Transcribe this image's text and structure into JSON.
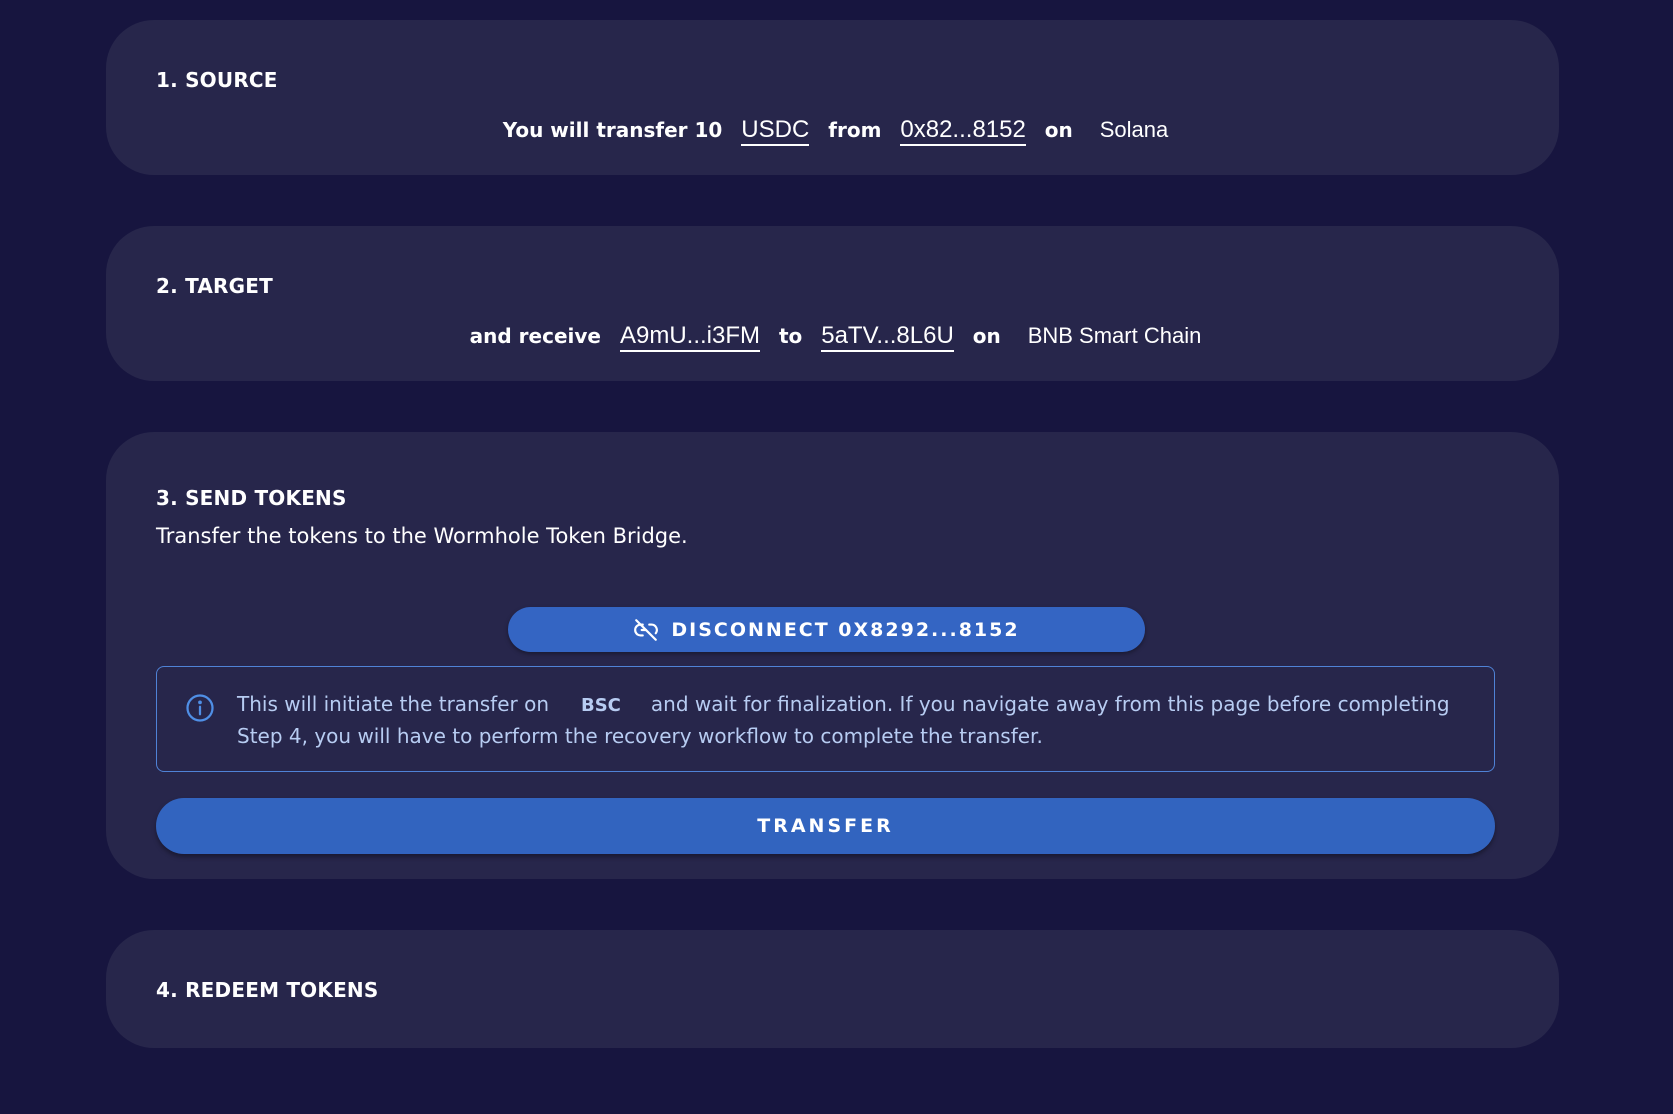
{
  "colors": {
    "background": "#17153f",
    "card": "#27264b",
    "primary_button": "#3264bf",
    "info_border": "#4f82d6",
    "info_text": "#b7ccf2"
  },
  "source": {
    "title": "1. SOURCE",
    "prefix": "You will transfer 10",
    "token": "USDC",
    "from_word": "from",
    "from_address": "0x82...8152",
    "on_word": "on",
    "chain": "Solana"
  },
  "target": {
    "title": "2. TARGET",
    "prefix": "and receive",
    "token": "A9mU...i3FM",
    "to_word": "to",
    "to_address": "5aTV...8L6U",
    "on_word": "on",
    "chain": "BNB Smart Chain"
  },
  "send": {
    "title": "3. SEND TOKENS",
    "description": "Transfer the tokens to the Wormhole Token Bridge.",
    "disconnect_icon": "link-off-icon",
    "disconnect_label": "DISCONNECT 0X8292...8152",
    "info_icon": "info-icon",
    "info_before": "This will initiate the transfer on",
    "info_chain": "BSC",
    "info_after": "and wait for finalization. If you navigate away from this page before completing Step 4, you will have to perform the recovery workflow to complete the transfer.",
    "transfer_label": "TRANSFER"
  },
  "redeem": {
    "title": "4. REDEEM TOKENS"
  }
}
